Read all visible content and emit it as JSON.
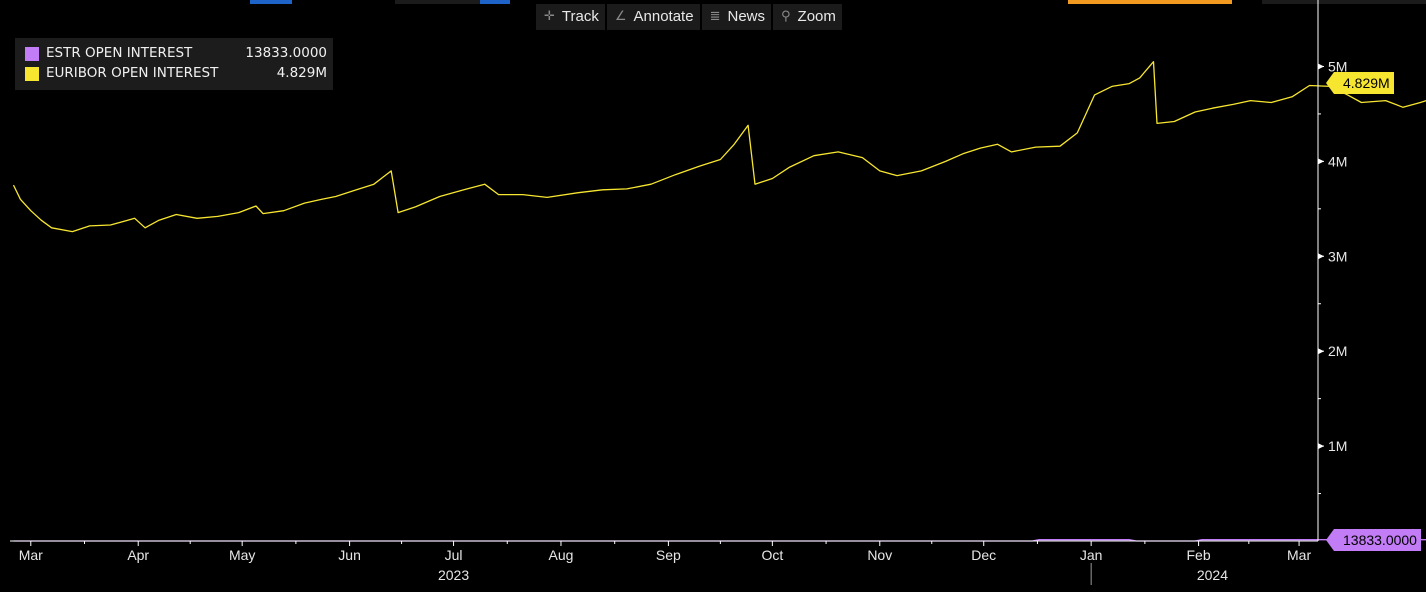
{
  "toolbar": {
    "track_label": "Track",
    "annotate_label": "Annotate",
    "news_label": "News",
    "zoom_label": "Zoom"
  },
  "legend": {
    "items": [
      {
        "name": "ESTR OPEN INTEREST",
        "value": "13833.0000",
        "color": "#c27cf5"
      },
      {
        "name": "EURIBOR OPEN INTEREST",
        "value": "4.829M",
        "color": "#f7e630"
      }
    ]
  },
  "value_tags": {
    "euribor": "4.829M",
    "estr": "13833.0000"
  },
  "colors": {
    "background": "#000000",
    "axis": "#ffffff",
    "estr": "#c27cf5",
    "euribor": "#f7e630",
    "legend_bg": "#1c1c1c",
    "toolbar_bg": "#1b1b1b"
  },
  "chart_data": {
    "type": "line",
    "grid": false,
    "legend_position": "top-left",
    "x_range": [
      "2023-02-23",
      "2024-03-03"
    ],
    "ylim": [
      0,
      5300000
    ],
    "y_ticks": [
      {
        "value": 1000000,
        "label": "1M"
      },
      {
        "value": 2000000,
        "label": "2M"
      },
      {
        "value": 3000000,
        "label": "3M"
      },
      {
        "value": 4000000,
        "label": "4M"
      },
      {
        "value": 5000000,
        "label": "5M"
      }
    ],
    "x_ticks": [
      {
        "date": "2023-03-01",
        "label": "Mar"
      },
      {
        "date": "2023-04-01",
        "label": "Apr"
      },
      {
        "date": "2023-05-01",
        "label": "May"
      },
      {
        "date": "2023-06-01",
        "label": "Jun"
      },
      {
        "date": "2023-07-01",
        "label": "Jul"
      },
      {
        "date": "2023-08-01",
        "label": "Aug"
      },
      {
        "date": "2023-09-01",
        "label": "Sep"
      },
      {
        "date": "2023-10-01",
        "label": "Oct"
      },
      {
        "date": "2023-11-01",
        "label": "Nov"
      },
      {
        "date": "2023-12-01",
        "label": "Dec"
      },
      {
        "date": "2024-01-01",
        "label": "Jan"
      },
      {
        "date": "2024-02-01",
        "label": "Feb"
      },
      {
        "date": "2024-03-01",
        "label": "Mar"
      }
    ],
    "year_labels": [
      {
        "date": "2023-07-01",
        "label": "2023"
      },
      {
        "date": "2024-02-05",
        "label": "2024"
      }
    ],
    "year_divider": "2024-01-01",
    "series": [
      {
        "name": "EURIBOR OPEN INTEREST",
        "color": "#f7e630",
        "points": [
          [
            "2023-02-24",
            3750000
          ],
          [
            "2023-02-26",
            3600000
          ],
          [
            "2023-03-01",
            3480000
          ],
          [
            "2023-03-04",
            3380000
          ],
          [
            "2023-03-07",
            3300000
          ],
          [
            "2023-03-13",
            3260000
          ],
          [
            "2023-03-18",
            3320000
          ],
          [
            "2023-03-24",
            3330000
          ],
          [
            "2023-03-31",
            3400000
          ],
          [
            "2023-04-03",
            3300000
          ],
          [
            "2023-04-07",
            3380000
          ],
          [
            "2023-04-12",
            3440000
          ],
          [
            "2023-04-18",
            3400000
          ],
          [
            "2023-04-24",
            3420000
          ],
          [
            "2023-04-30",
            3460000
          ],
          [
            "2023-05-05",
            3530000
          ],
          [
            "2023-05-07",
            3450000
          ],
          [
            "2023-05-13",
            3480000
          ],
          [
            "2023-05-19",
            3560000
          ],
          [
            "2023-05-24",
            3600000
          ],
          [
            "2023-05-28",
            3630000
          ],
          [
            "2023-06-03",
            3700000
          ],
          [
            "2023-06-08",
            3760000
          ],
          [
            "2023-06-13",
            3900000
          ],
          [
            "2023-06-15",
            3460000
          ],
          [
            "2023-06-20",
            3520000
          ],
          [
            "2023-06-27",
            3630000
          ],
          [
            "2023-07-04",
            3700000
          ],
          [
            "2023-07-10",
            3760000
          ],
          [
            "2023-07-14",
            3650000
          ],
          [
            "2023-07-21",
            3650000
          ],
          [
            "2023-07-28",
            3620000
          ],
          [
            "2023-08-06",
            3670000
          ],
          [
            "2023-08-13",
            3700000
          ],
          [
            "2023-08-20",
            3710000
          ],
          [
            "2023-08-27",
            3760000
          ],
          [
            "2023-09-03",
            3860000
          ],
          [
            "2023-09-10",
            3950000
          ],
          [
            "2023-09-16",
            4020000
          ],
          [
            "2023-09-20",
            4180000
          ],
          [
            "2023-09-24",
            4380000
          ],
          [
            "2023-09-26",
            3760000
          ],
          [
            "2023-10-01",
            3820000
          ],
          [
            "2023-10-06",
            3940000
          ],
          [
            "2023-10-13",
            4060000
          ],
          [
            "2023-10-20",
            4100000
          ],
          [
            "2023-10-27",
            4040000
          ],
          [
            "2023-11-01",
            3900000
          ],
          [
            "2023-11-06",
            3850000
          ],
          [
            "2023-11-13",
            3900000
          ],
          [
            "2023-11-20",
            4000000
          ],
          [
            "2023-11-25",
            4080000
          ],
          [
            "2023-11-30",
            4140000
          ],
          [
            "2023-12-05",
            4180000
          ],
          [
            "2023-12-09",
            4100000
          ],
          [
            "2023-12-16",
            4150000
          ],
          [
            "2023-12-23",
            4160000
          ],
          [
            "2023-12-28",
            4300000
          ],
          [
            "2024-01-02",
            4700000
          ],
          [
            "2024-01-07",
            4790000
          ],
          [
            "2024-01-12",
            4820000
          ],
          [
            "2024-01-15",
            4880000
          ],
          [
            "2024-01-19",
            5050000
          ],
          [
            "2024-01-20",
            4400000
          ],
          [
            "2024-01-25",
            4420000
          ],
          [
            "2024-01-31",
            4520000
          ],
          [
            "2024-02-05",
            4560000
          ],
          [
            "2024-02-11",
            4600000
          ],
          [
            "2024-02-16",
            4640000
          ],
          [
            "2024-02-22",
            4620000
          ],
          [
            "2024-02-28",
            4680000
          ],
          [
            "2024-03-04",
            4800000
          ],
          [
            "2024-03-10",
            4790000
          ],
          [
            "2024-03-15",
            4700000
          ],
          [
            "2024-03-19",
            4620000
          ],
          [
            "2024-03-26",
            4640000
          ],
          [
            "2024-03-31",
            4570000
          ],
          [
            "2024-04-05",
            4620000
          ],
          [
            "2024-04-12",
            4700000
          ],
          [
            "2024-04-18",
            4790000
          ],
          [
            "2024-04-24",
            4780000
          ],
          [
            "2024-04-28",
            4829000
          ]
        ]
      },
      {
        "name": "ESTR OPEN INTEREST",
        "color": "#c27cf5",
        "points": [
          [
            "2023-02-24",
            0
          ],
          [
            "2023-12-15",
            0
          ],
          [
            "2023-12-17",
            13833
          ],
          [
            "2024-01-12",
            13833
          ],
          [
            "2024-01-14",
            0
          ],
          [
            "2024-01-31",
            0
          ],
          [
            "2024-02-02",
            13833
          ],
          [
            "2024-04-28",
            13833
          ]
        ]
      }
    ]
  }
}
